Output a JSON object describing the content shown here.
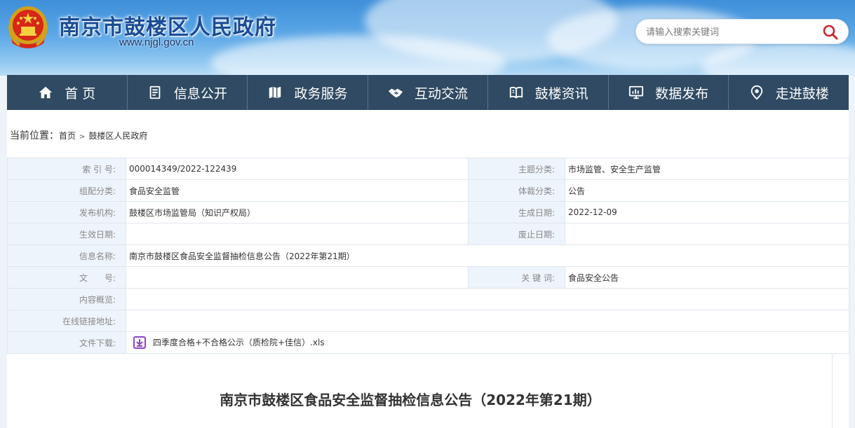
{
  "header": {
    "site_title": "南京市鼓楼区人民政府",
    "site_url": "www.njgl.gov.cn",
    "emblem": "national-emblem-icon"
  },
  "search": {
    "placeholder": "请输入搜索关键词",
    "icon": "search-icon"
  },
  "nav": [
    {
      "label": "首 页",
      "icon": "home-icon"
    },
    {
      "label": "信息公开",
      "icon": "document-icon"
    },
    {
      "label": "政务服务",
      "icon": "map-icon"
    },
    {
      "label": "互动交流",
      "icon": "handshake-icon"
    },
    {
      "label": "鼓楼资讯",
      "icon": "book-icon"
    },
    {
      "label": "数据发布",
      "icon": "monitor-chart-icon"
    },
    {
      "label": "走进鼓楼",
      "icon": "location-pin-icon"
    }
  ],
  "breadcrumb": {
    "prefix": "当前位置：",
    "items": [
      "首页",
      "鼓楼区人民政府"
    ],
    "separator": ">"
  },
  "info": {
    "index_no_label": "索 引 号:",
    "index_no": "000014349/2022-122439",
    "topic_label": "主题分类:",
    "topic": "市场监管、安全生产监管",
    "org_label": "组配分类:",
    "org": "食品安全监管",
    "genre_label": "体裁分类:",
    "genre": "公告",
    "publisher_label": "发布机构:",
    "publisher": "鼓楼区市场监管局（知识产权局）",
    "created_label": "生成日期:",
    "created": "2022-12-09",
    "effective_label": "生效日期:",
    "effective": "",
    "abolished_label": "废止日期:",
    "abolished": "",
    "name_label": "信息名称:",
    "name": "南京市鼓楼区食品安全监督抽检信息公告（2022年第21期）",
    "doc_no_label": "文　　号:",
    "doc_no": "",
    "keywords_label": "关 键 词:",
    "keywords": "食品安全公告",
    "summary_label": "内容概览:",
    "summary": "",
    "link_label": "在线链接地址:",
    "link": "",
    "download_label": "文件下载:",
    "download_file": "四季度合格+不合格公示（质检院+佳信）.xls"
  },
  "article": {
    "title": "南京市鼓楼区食品安全监督抽检信息公告（2022年第21期）"
  },
  "colors": {
    "nav_bg": "#2f4a62",
    "title_blue": "#1a4c97",
    "key_cell_bg": "#eef4fb",
    "search_red": "#c8272d",
    "download_purple": "#8e44c8"
  }
}
